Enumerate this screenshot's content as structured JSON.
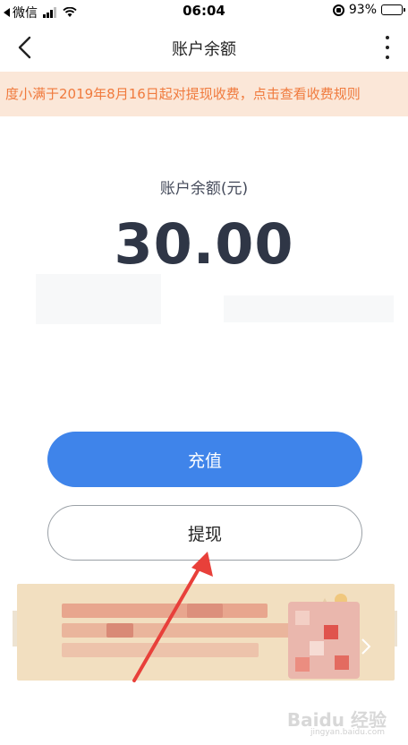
{
  "status_bar": {
    "carrier": "微信",
    "time": "06:04",
    "battery": "93%",
    "battery_level": 0.93
  },
  "nav": {
    "title": "账户余额"
  },
  "notice": {
    "text": "度小满于2019年8月16日起对提现收费，点击查看收费规则"
  },
  "balance": {
    "label": "账户余额(元)",
    "amount": "30.00"
  },
  "actions": {
    "recharge_label": "充值",
    "withdraw_label": "提现"
  },
  "watermark": {
    "text": "Baidu 经验",
    "sub": "jingyan.baidu.com"
  },
  "colors": {
    "primary_button": "#3f84ea",
    "notice_bg": "#fbe7d8",
    "notice_text": "#f07a3d",
    "annotation_arrow": "#e8403a"
  }
}
